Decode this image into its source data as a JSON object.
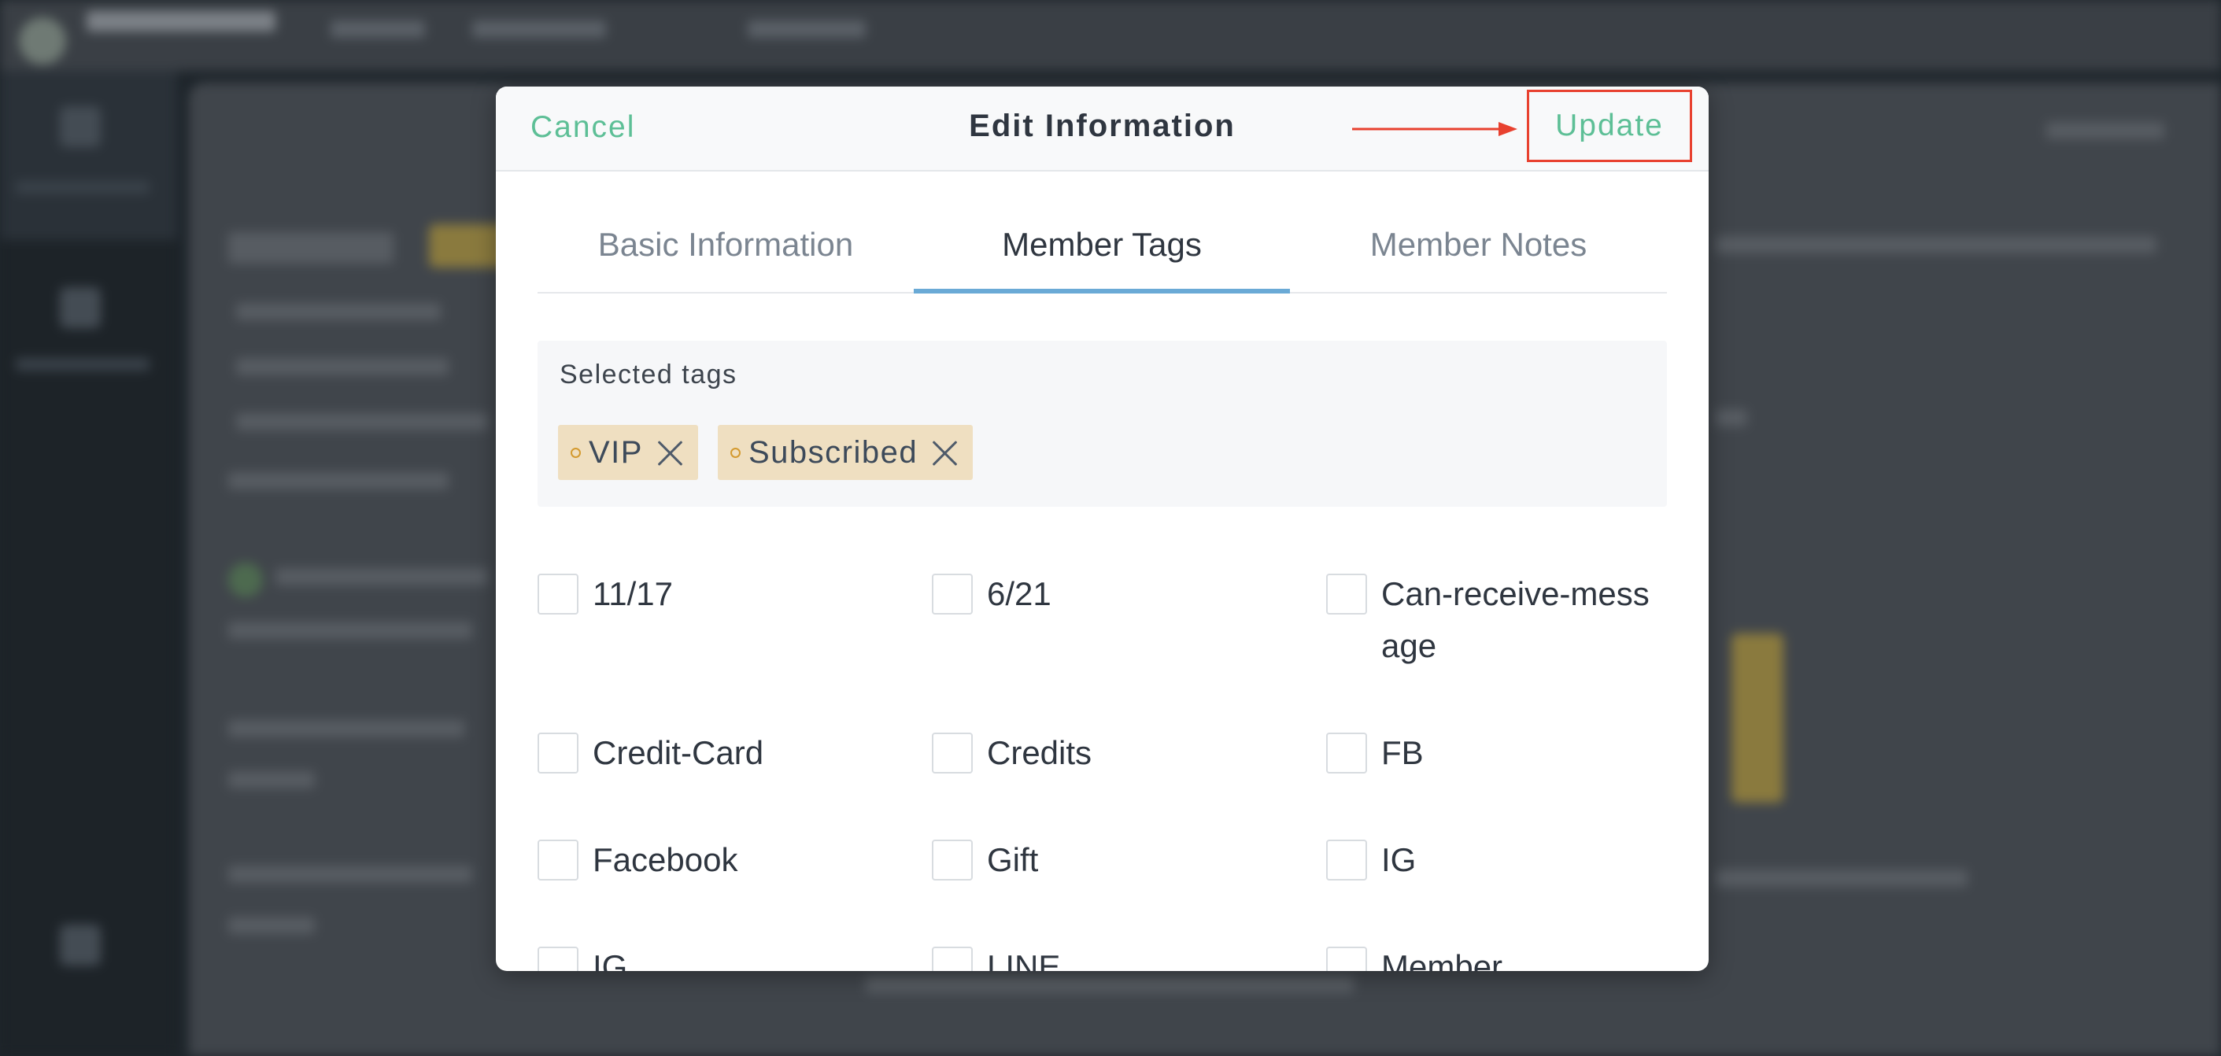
{
  "modal": {
    "cancel_label": "Cancel",
    "title": "Edit Information",
    "update_label": "Update",
    "highlight_color": "#e8412f",
    "accent_color": "#5dbf96"
  },
  "tabs": [
    {
      "label": "Basic Information",
      "active": false
    },
    {
      "label": "Member Tags",
      "active": true
    },
    {
      "label": "Member Notes",
      "active": false
    }
  ],
  "selected": {
    "label": "Selected tags",
    "tags": [
      {
        "label": "VIP"
      },
      {
        "label": "Subscribed"
      }
    ]
  },
  "options": [
    {
      "label": "11/17",
      "checked": false
    },
    {
      "label": "6/21",
      "checked": false
    },
    {
      "label": "Can-receive-message",
      "checked": false
    },
    {
      "label": "Credit-Card",
      "checked": false
    },
    {
      "label": "Credits",
      "checked": false
    },
    {
      "label": "FB",
      "checked": false
    },
    {
      "label": "Facebook",
      "checked": false
    },
    {
      "label": "Gift",
      "checked": false
    },
    {
      "label": "IG",
      "checked": false
    },
    {
      "label": "IG",
      "checked": false
    },
    {
      "label": "LINE",
      "checked": false
    },
    {
      "label": "Member",
      "checked": false
    }
  ]
}
